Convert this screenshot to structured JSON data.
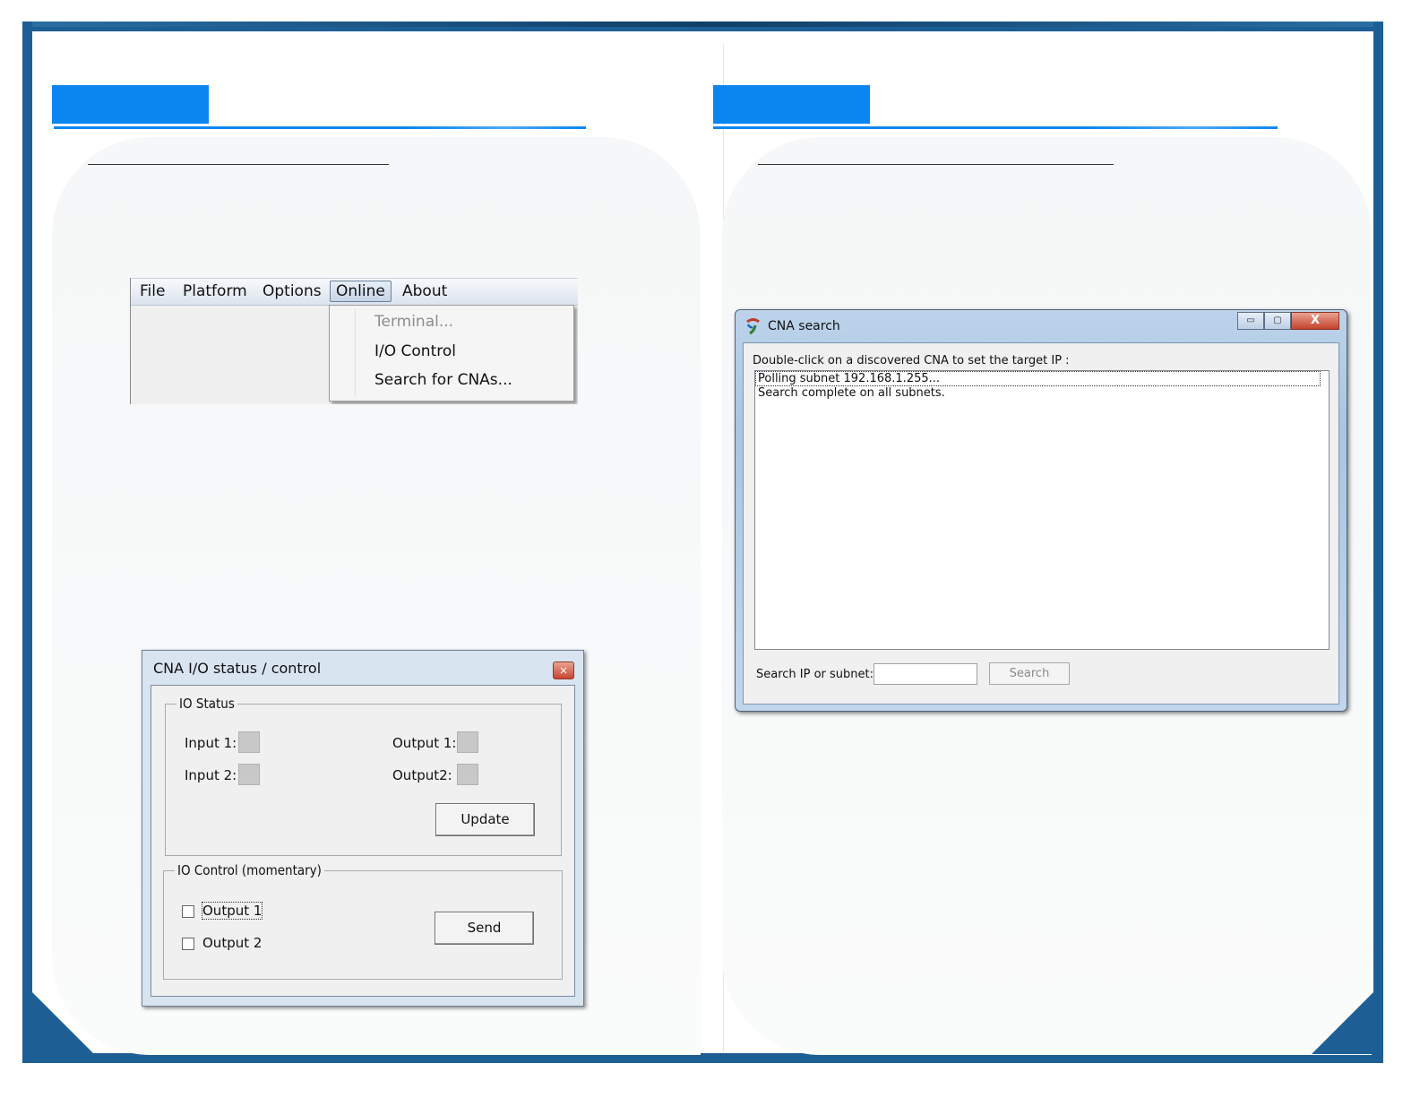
{
  "menu_screenshot": {
    "menubar": [
      "File",
      "Platform",
      "Options",
      "Online",
      "About"
    ],
    "dropdown": [
      {
        "label": "Terminal...",
        "disabled": true
      },
      {
        "label": "I/O Control",
        "disabled": false
      },
      {
        "label": "Search for CNAs...",
        "disabled": false
      }
    ]
  },
  "io_dialog": {
    "title": "CNA I/O   status / control",
    "close_glyph": "×",
    "status_group": "IO Status",
    "input1": "Input 1:",
    "input2": "Input 2:",
    "output1": "Output 1:",
    "output2": "Output2:",
    "update_button": "Update",
    "control_group": "IO Control (momentary)",
    "check_output1": "Output 1",
    "check_output2": "Output 2",
    "send_button": "Send"
  },
  "search_window": {
    "title": "CNA search",
    "minimize_glyph": "▭",
    "maximize_glyph": "▢",
    "close_glyph": "X",
    "instruction": "Double-click on a discovered CNA to set the target IP :",
    "list_rows": [
      "Polling subnet 192.168.1.255...",
      "Search complete on all subnets."
    ],
    "search_label": "Search IP or subnet:",
    "search_value": "",
    "search_button": "Search"
  },
  "colors": {
    "frame": "#1d5f95",
    "tab": "#0b86f0"
  }
}
